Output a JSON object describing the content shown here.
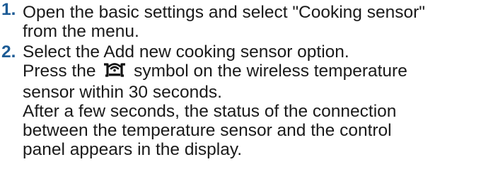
{
  "instructions": {
    "steps": [
      {
        "number": "1.",
        "lines": [
          "Open the basic settings and select \"Cooking sensor\"",
          "from the menu."
        ]
      },
      {
        "number": "2.",
        "lines": [
          "Select the Add new cooking sensor option."
        ],
        "press_line": {
          "before": "Press the",
          "icon": "sensor-connect-icon",
          "after": "symbol on the wireless temperature"
        },
        "lines_after": [
          "sensor within 30 seconds.",
          "After a few seconds, the status of the connection",
          "between the temperature sensor and the control",
          "panel appears in the display."
        ]
      }
    ]
  },
  "colors": {
    "step_number": "#1c5b95",
    "text": "#1a1a1a"
  }
}
